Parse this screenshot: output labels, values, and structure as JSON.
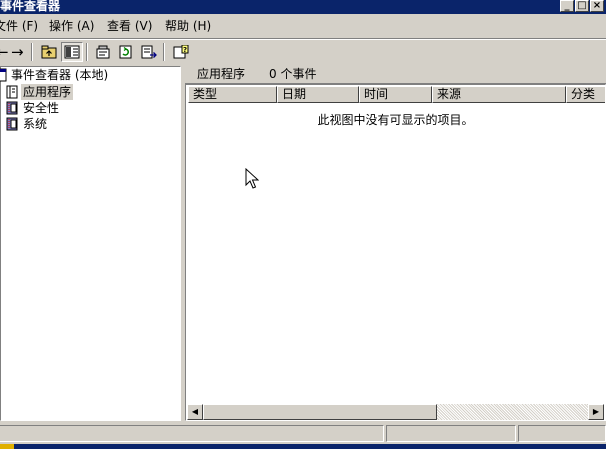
{
  "window": {
    "title": "事件查看器"
  },
  "menu": [
    "文件 (F)",
    "操作 (A)",
    "查看 (V)",
    "帮助 (H)"
  ],
  "toolbar": {
    "buttons": [
      "back-icon",
      "forward-icon",
      "up-folder-icon",
      "show-hide-tree-icon",
      "properties-icon",
      "refresh-icon",
      "export-list-icon",
      "help-icon"
    ]
  },
  "tree": {
    "root": "事件查看器 (本地)",
    "items": [
      "应用程序",
      "安全性",
      "系统"
    ],
    "selected": "应用程序"
  },
  "pane": {
    "header_title": "应用程序",
    "event_count": "0 个事件",
    "columns": [
      "类型",
      "日期",
      "时间",
      "来源",
      "分类"
    ],
    "empty_message": "此视图中没有可显示的项目。"
  }
}
